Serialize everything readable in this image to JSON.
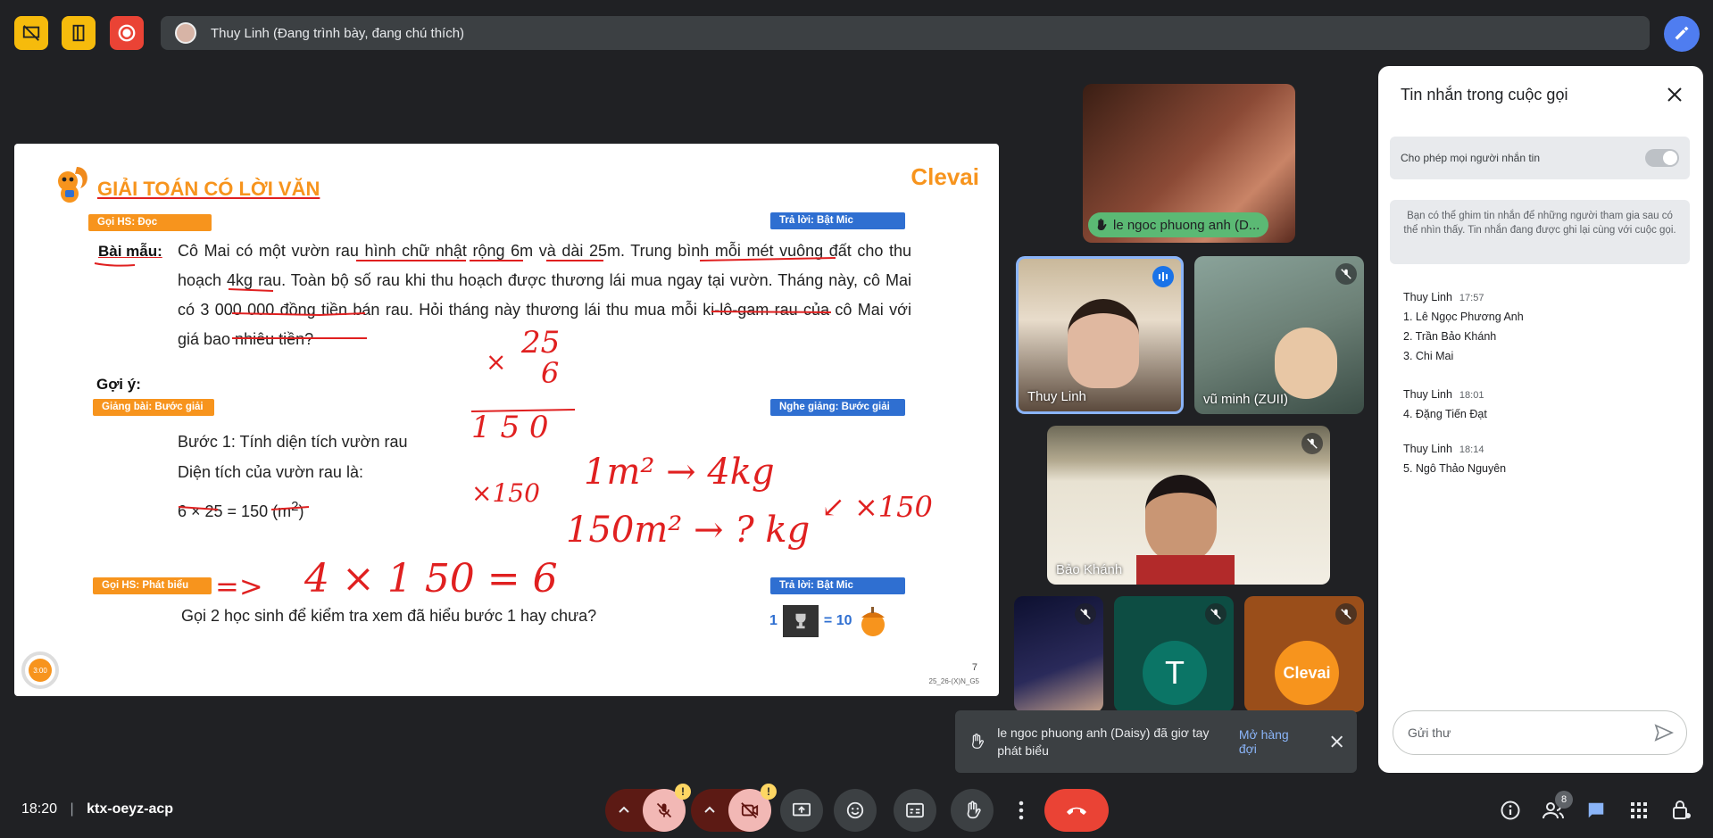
{
  "top_bar": {
    "presenter_label": "Thuy Linh (Đang trình bày, đang chú thích)",
    "colors": {
      "yellow_button": "#f6bb0c",
      "record_button": "#ea4335",
      "pen_button": "#4f7df0"
    }
  },
  "slide": {
    "title": "GIẢI TOÁN CÓ LỜI VĂN",
    "logo": "Clevai",
    "tags": {
      "goi_hs_doc": "Gọi HS: Đọc",
      "tra_loi_1": "Trả lời: Bật Mic",
      "giang_bai": "Giảng bài: Bước giải",
      "nghe_giang": "Nghe giảng: Bước giải",
      "goi_hs_phat_bieu": "Gọi HS: Phát biểu",
      "tra_loi_2": "Trả lời: Bật Mic"
    },
    "bai_mau_label": "Bài mẫu:",
    "bai_mau_text": "Cô Mai có một vườn rau hình chữ nhật rộng 6m và dài 25m. Trung bình mỗi mét vuông đất cho thu hoạch 4kg rau. Toàn bộ số rau khi thu hoạch được thương lái mua ngay tại vườn. Tháng này, cô Mai có 3 000 000 đồng tiền bán rau. Hỏi tháng này thương lái thu mua mỗi ki-lô-gam rau của cô Mai với giá bao nhiêu tiền?",
    "goi_y_label": "Gợi ý:",
    "buoc_1": "Bước 1: Tính diện tích vườn rau",
    "dien_tich_label": "Diện tích của vườn rau là:",
    "calc": "6 × 25 = 150 (m",
    "calc_sup": "2",
    "calc_end": ")",
    "question": "Gọi 2 học sinh để kiểm tra xem đã hiểu bước 1 hay chưa?",
    "reward_count": "1",
    "reward_eq": "= 10",
    "page_number": "7",
    "page_code": "25_26-(X)N_G5",
    "timer": "3:00",
    "handwriting": {
      "h25": "25",
      "hx": "×",
      "h6": "6",
      "h150": "1 5 0",
      "hx150": "×150",
      "h1m2": "1m² → 4kg",
      "h150m2": "150m² → ? kg",
      "h4x150": "4 × 1 50 = 6",
      "harrow": "=>",
      "hright": "↙ ×150"
    }
  },
  "participants": [
    {
      "name": "le ngoc phuong anh (D...",
      "hand_raised": true
    },
    {
      "name": "Thuy Linh",
      "speaking": true
    },
    {
      "name": "vũ minh (ZUII)",
      "muted": true
    },
    {
      "name": "Bảo Khánh",
      "muted": true
    },
    {
      "name": "",
      "muted": true
    },
    {
      "name": "",
      "initial": "T",
      "muted": true
    },
    {
      "name": "",
      "logo": "Clevai",
      "muted": true
    }
  ],
  "chat": {
    "title": "Tin nhắn trong cuộc gọi",
    "toggle_label": "Cho phép mọi người nhắn tin",
    "toggle_on": true,
    "info": "Bạn có thể ghim tin nhắn để những người tham gia sau có thể nhìn thấy. Tin nhắn đang được ghi lại cùng với cuộc gọi.",
    "messages": [
      {
        "sender": "Thuy Linh",
        "time": "17:57",
        "lines": [
          "1. Lê Ngọc Phương Anh",
          "2. Trần Bảo Khánh",
          "3. Chi Mai"
        ]
      },
      {
        "sender": "Thuy Linh",
        "time": "18:01",
        "lines": [
          "4. Đặng Tiến Đạt"
        ]
      },
      {
        "sender": "Thuy Linh",
        "time": "18:14",
        "lines": [
          "5. Ngô Thảo Nguyên"
        ]
      }
    ],
    "input_placeholder": "Gửi thư"
  },
  "notification": {
    "text": "le ngoc phuong anh (Daisy) đã giơ tay phát biểu",
    "action": "Mở hàng đợi"
  },
  "bottom_bar": {
    "time": "18:20",
    "meeting_code": "ktx-oeyz-acp",
    "warning_mark": "!",
    "people_count": "8"
  }
}
